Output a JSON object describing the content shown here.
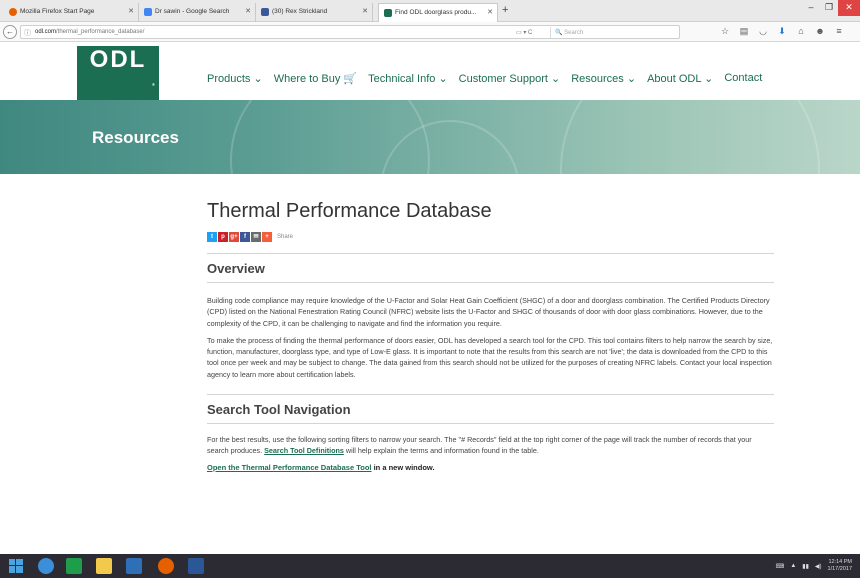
{
  "browser": {
    "tabs": [
      {
        "label": "Mozilla Firefox Start Page",
        "color": "#e66000"
      },
      {
        "label": "Dr sawin - Google Search",
        "color": "#4285f4"
      },
      {
        "label": "(30) Rex Strickland",
        "color": "#3b5998"
      },
      {
        "label": "Find ODL doorglass produ...",
        "color": "#1b6e52"
      }
    ],
    "new_tab_glyph": "+",
    "url_domain": "odl.com",
    "url_path": "/thermal_performance_database/",
    "search_placeholder": "Search",
    "url_controls": "▭ ▾ C"
  },
  "site": {
    "logo_text": "ODL",
    "logo_mark": "®",
    "nav": [
      {
        "label": "Products",
        "suffix": "⌄"
      },
      {
        "label": "Where to Buy",
        "suffix": "🛒"
      },
      {
        "label": "Technical Info",
        "suffix": "⌄"
      },
      {
        "label": "Customer Support",
        "suffix": "⌄"
      },
      {
        "label": "Resources",
        "suffix": "⌄"
      },
      {
        "label": "About ODL",
        "suffix": "⌄"
      },
      {
        "label": "Contact",
        "suffix": ""
      }
    ],
    "banner_title": "Resources",
    "accent_color": "#1b6e52"
  },
  "content": {
    "page_title": "Thermal Performance Database",
    "share_label": "Share",
    "share_buttons": [
      {
        "glyph": "t",
        "color": "#1da1f2"
      },
      {
        "glyph": "p",
        "color": "#cb2027"
      },
      {
        "glyph": "g+",
        "color": "#dd4b39"
      },
      {
        "glyph": "f",
        "color": "#3b5998"
      },
      {
        "glyph": "✉",
        "color": "#6b6b6b"
      },
      {
        "glyph": "+",
        "color": "#f65e3b"
      }
    ],
    "overview_title": "Overview",
    "overview_p1": "Building code compliance may require knowledge of the U-Factor and Solar Heat Gain Coefficient (SHGC) of a door and doorglass combination. The Certified Products Directory (CPD) listed on the National Fenestration Rating Council (NFRC) website lists the U-Factor and SHGC of thousands of door with door glass combinations. However, due to the complexity of the CPD, it can be challenging to navigate and find the information you require.",
    "overview_p2": "To make the process of finding the thermal performance of doors easier, ODL has developed a search tool for the CPD. This tool contains filters to help narrow the search by size, function, manufacturer, doorglass type, and type of Low-E glass. It is important to note that the results from this search are not 'live'; the data is downloaded from the CPD to this tool once per week and may be subject to change. The data gained from this search should not be utilized for the purposes of creating NFRC labels. Contact your local inspection agency to learn more about certification labels.",
    "nav_title": "Search Tool Navigation",
    "nav_p_before": "For the best results, use the following sorting filters to narrow your search. The \"# Records\" field at the top right corner of the page will track the number of records that your search produces. ",
    "nav_p_link": "Search Tool Definitions",
    "nav_p_after": " will help explain the terms and information found in the table.",
    "open_link": "Open the Thermal Performance Database Tool",
    "open_suffix": " in a new window."
  },
  "taskbar": {
    "apps": [
      {
        "name": "windows-start",
        "color": "#4aa3df"
      },
      {
        "name": "edge",
        "color": "#3b8fd8"
      },
      {
        "name": "store",
        "color": "#1e9e4a"
      },
      {
        "name": "file-explorer",
        "color": "#f2c94c"
      },
      {
        "name": "outlook",
        "color": "#2f6fb7"
      },
      {
        "name": "firefox",
        "color": "#e66000"
      },
      {
        "name": "word",
        "color": "#2b5797"
      }
    ],
    "clock_time": "12:14 PM",
    "clock_date": "1/17/2017"
  }
}
